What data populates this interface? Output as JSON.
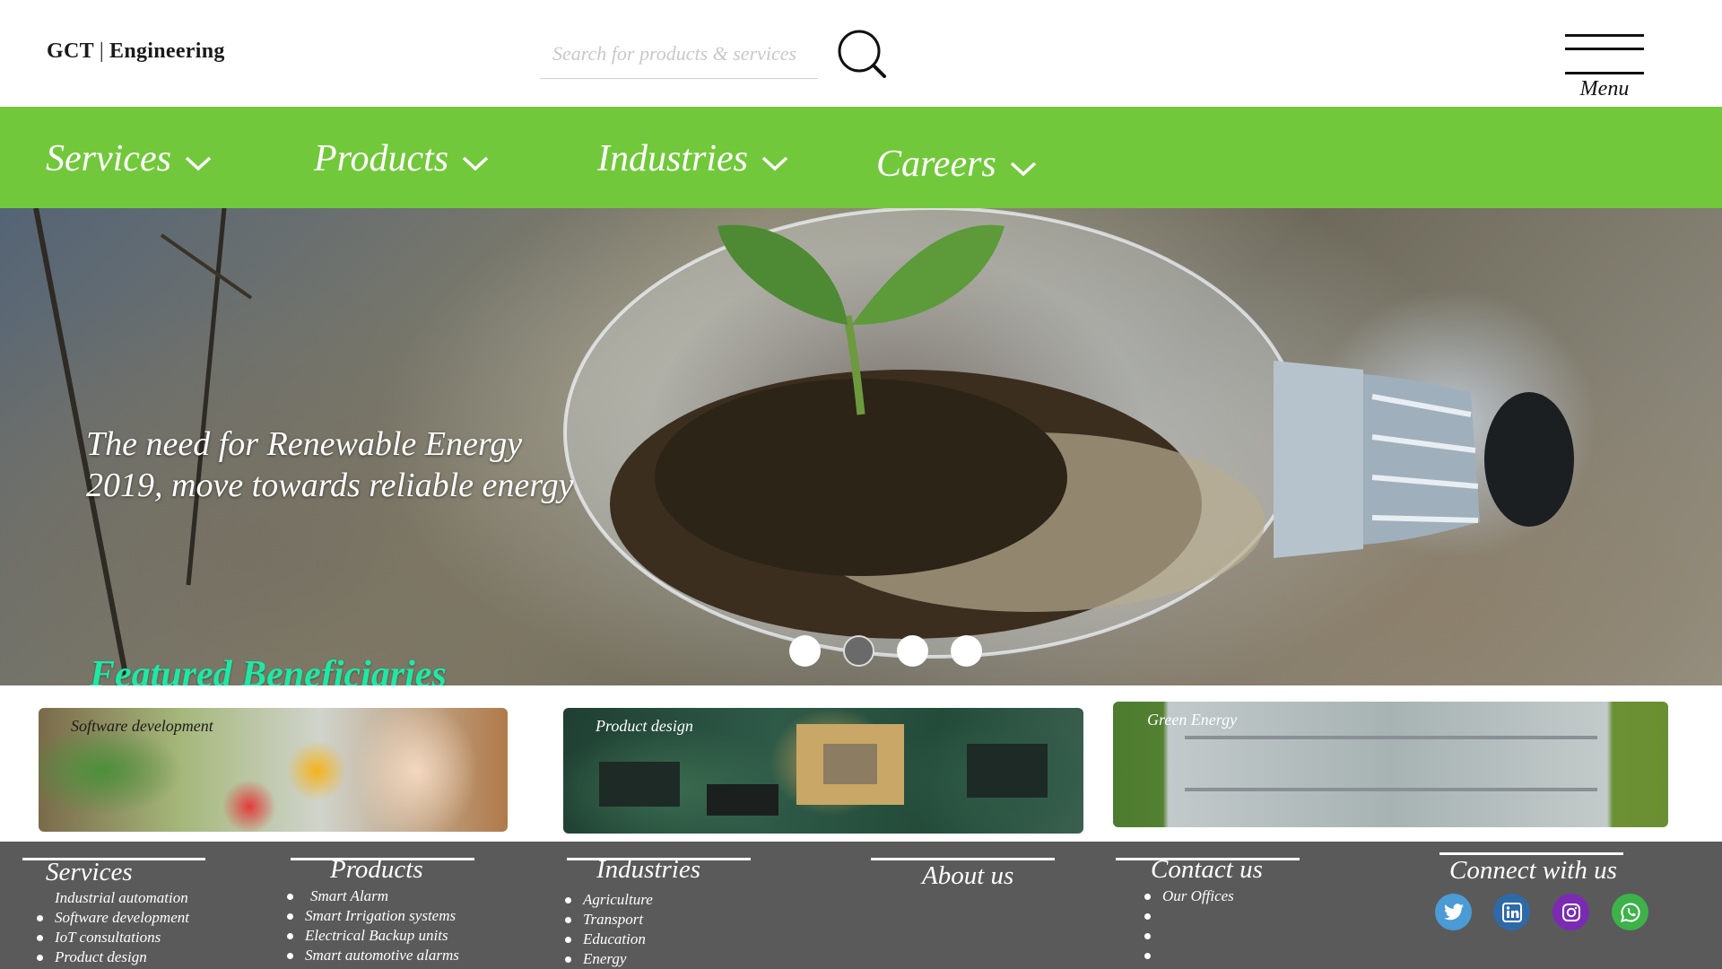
{
  "header": {
    "logo_left": "GCT",
    "logo_separator": "|",
    "logo_right": "Engineering",
    "search_placeholder": "Search for products & services",
    "search_icon": "search-icon",
    "menu_label": "Menu",
    "menu_icon": "hamburger-icon"
  },
  "nav": {
    "items": [
      {
        "label": "Services",
        "icon": "chevron-down-icon"
      },
      {
        "label": "Products",
        "icon": "chevron-down-icon"
      },
      {
        "label": "Industries",
        "icon": "chevron-down-icon"
      },
      {
        "label": "Careers",
        "icon": "chevron-down-icon"
      }
    ],
    "background": "#72c83b"
  },
  "hero": {
    "line1": "The need for Renewable Energy",
    "line2": "2019, move towards reliable energy",
    "slides_count": 4,
    "active_slide": 2
  },
  "featured": {
    "title": "Featured Beneficiaries",
    "title_color": "#1de9a5",
    "cards": [
      {
        "label": "Software development"
      },
      {
        "label": "Product design"
      },
      {
        "label": "Green Energy"
      }
    ]
  },
  "footer": {
    "background": "#5a5a5a",
    "services": {
      "heading": "Services",
      "items": [
        "Industrial automation",
        "Software development",
        "IoT consultations",
        "Product design"
      ]
    },
    "products": {
      "heading": "Products",
      "items": [
        "Smart Alarm",
        "Smart Irrigation systems",
        "Electrical Backup units",
        "Smart automotive alarms"
      ]
    },
    "industries": {
      "heading": "Industries",
      "items": [
        "Agriculture",
        "Transport",
        "Education",
        "Energy"
      ]
    },
    "about": {
      "heading": "About us"
    },
    "contact": {
      "heading": "Contact us",
      "items": [
        "Our Offices"
      ]
    },
    "connect": {
      "heading": "Connect with us",
      "socials": [
        {
          "icon": "twitter-icon",
          "color": "#4a9bd6"
        },
        {
          "icon": "linkedin-icon",
          "color": "#2e6aa8"
        },
        {
          "icon": "instagram-icon",
          "color": "#7b2bb3"
        },
        {
          "icon": "whatsapp-icon",
          "color": "#3db14a"
        }
      ]
    }
  }
}
